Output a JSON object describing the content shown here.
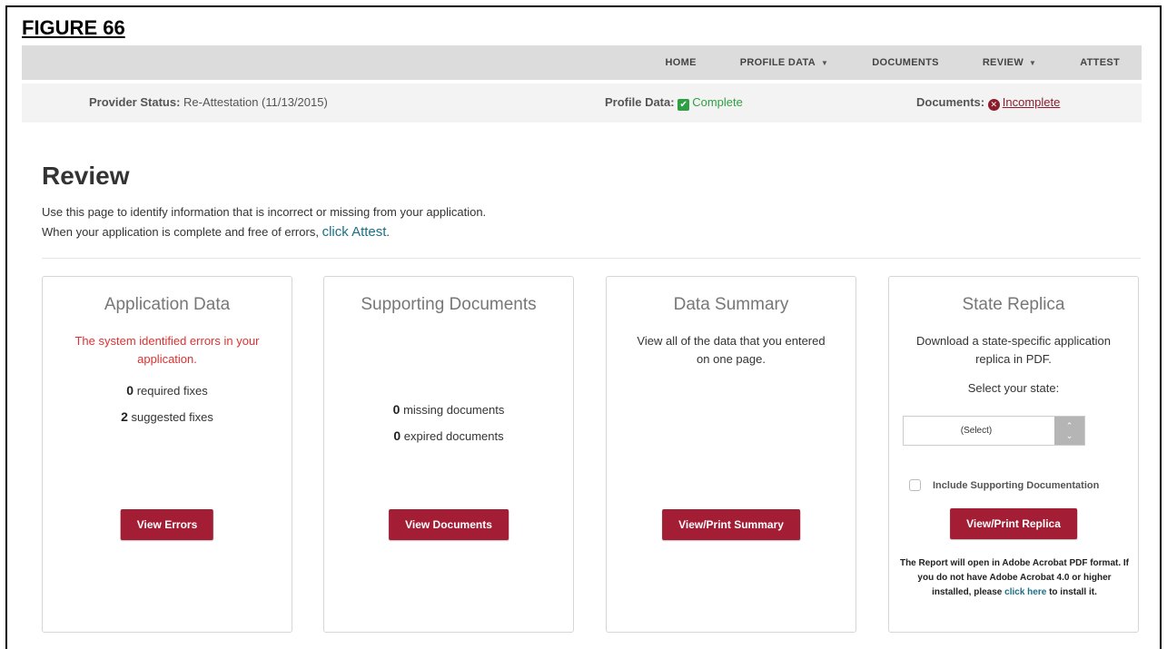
{
  "figure_label": "FIGURE 66",
  "nav": {
    "items": [
      {
        "label": "HOME",
        "dropdown": false
      },
      {
        "label": "PROFILE DATA",
        "dropdown": true
      },
      {
        "label": "DOCUMENTS",
        "dropdown": false
      },
      {
        "label": "REVIEW",
        "dropdown": true
      },
      {
        "label": "ATTEST",
        "dropdown": false
      }
    ]
  },
  "status": {
    "provider_label": "Provider Status:",
    "provider_value": "Re-Attestation (11/13/2015)",
    "profile_label": "Profile Data:",
    "profile_value": "Complete",
    "documents_label": "Documents:",
    "documents_value": "Incomplete"
  },
  "page": {
    "title": "Review",
    "intro_line1": "Use this page to identify information that is incorrect or missing from your application.",
    "intro_line2": "When your application is complete and free of errors,",
    "intro_link": "click Attest",
    "intro_end": "."
  },
  "cards": {
    "application": {
      "title": "Application Data",
      "error": "The system identified errors in your application.",
      "required_count": "0",
      "required_label": "required fixes",
      "suggested_count": "2",
      "suggested_label": "suggested fixes",
      "button": "View Errors"
    },
    "supporting": {
      "title": "Supporting Documents",
      "missing_count": "0",
      "missing_label": "missing documents",
      "expired_count": "0",
      "expired_label": "expired documents",
      "button": "View Documents"
    },
    "summary": {
      "title": "Data Summary",
      "desc": "View all of the data that you entered on one page.",
      "button": "View/Print Summary"
    },
    "replica": {
      "title": "State Replica",
      "desc": "Download a state-specific application replica in PDF.",
      "select_label": "Select your state:",
      "select_value": "(Select)",
      "checkbox_label": "Include Supporting Documentation",
      "checkbox_checked": false,
      "button": "View/Print Replica",
      "note": "The Report will open in Adobe Acrobat PDF format. If you do not have Adobe Acrobat 4.0 or higher installed, please",
      "note_link": "click here",
      "note_end": "to install it."
    }
  },
  "colors": {
    "nav_bg": "#dcdcdc",
    "status_bg": "#f3f3f3",
    "button": "#a31d35",
    "success": "#2ea043",
    "error": "#e03030",
    "link": "#1b6f86"
  },
  "icons": {
    "complete": "check-square-icon",
    "incomplete": "x-circle-icon",
    "dropdown": "caret-down-icon",
    "select_spinner": "up-down-chevron-icon"
  }
}
